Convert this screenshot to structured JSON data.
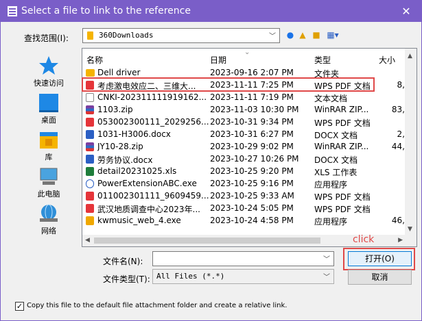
{
  "window": {
    "title": "Select a file to link to the reference",
    "close_glyph": "✕"
  },
  "lookin": {
    "label": "查找范围(I):",
    "value": "360Downloads"
  },
  "toolbar": [
    "back-icon",
    "up-folder-icon",
    "new-folder-icon",
    "view-menu-icon"
  ],
  "places": [
    {
      "label": "快速访问",
      "icon": "star-icon"
    },
    {
      "label": "桌面",
      "icon": "desktop-icon"
    },
    {
      "label": "库",
      "icon": "library-icon"
    },
    {
      "label": "此电脑",
      "icon": "computer-icon"
    },
    {
      "label": "网络",
      "icon": "network-icon"
    }
  ],
  "columns": {
    "name": "名称",
    "date": "日期",
    "type": "类型",
    "size": "大小"
  },
  "files": [
    {
      "name": "Dell driver",
      "date": "2023-09-16 2:07 PM",
      "type": "文件夹",
      "size": "",
      "icon": "folder"
    },
    {
      "name": "考虑激电效应二、三维大...",
      "date": "2023-11-11 7:25 PM",
      "type": "WPS PDF 文档",
      "size": "8,",
      "icon": "pdf"
    },
    {
      "name": "CNKI-202311111919162...",
      "date": "2023-11-11 7:19 PM",
      "type": "文本文档",
      "size": "",
      "icon": "txt"
    },
    {
      "name": "1103.zip",
      "date": "2023-11-03 10:30 PM",
      "type": "WinRAR ZIP...",
      "size": "83,",
      "icon": "zip"
    },
    {
      "name": "053002300111_2029256...",
      "date": "2023-10-31 9:34 PM",
      "type": "WPS PDF 文档",
      "size": "",
      "icon": "pdf"
    },
    {
      "name": "1031-H3006.docx",
      "date": "2023-10-31 6:27 PM",
      "type": "DOCX 文档",
      "size": "2,",
      "icon": "docx"
    },
    {
      "name": "JY10-28.zip",
      "date": "2023-10-29 9:02 PM",
      "type": "WinRAR ZIP...",
      "size": "44,",
      "icon": "zip"
    },
    {
      "name": "劳务协议.docx",
      "date": "2023-10-27 10:26 PM",
      "type": "DOCX 文档",
      "size": "",
      "icon": "docx"
    },
    {
      "name": "detail20231025.xls",
      "date": "2023-10-25 9:20 PM",
      "type": "XLS 工作表",
      "size": "",
      "icon": "xls"
    },
    {
      "name": "PowerExtensionABC.exe",
      "date": "2023-10-25 9:16 PM",
      "type": "应用程序",
      "size": "",
      "icon": "exe"
    },
    {
      "name": "011002301111_9609459...",
      "date": "2023-10-25 9:33 AM",
      "type": "WPS PDF 文档",
      "size": "",
      "icon": "pdf"
    },
    {
      "name": "武汉地质调查中心2023年...",
      "date": "2023-10-24 5:05 PM",
      "type": "WPS PDF 文档",
      "size": "",
      "icon": "pdf"
    },
    {
      "name": "kwmusic_web_4.exe",
      "date": "2023-10-24 4:58 PM",
      "type": "应用程序",
      "size": "46,",
      "icon": "music"
    }
  ],
  "filename": {
    "label": "文件名(N):",
    "value": ""
  },
  "filetype": {
    "label": "文件类型(T):",
    "value": "All Files (*.*)"
  },
  "buttons": {
    "open": "打开(O)",
    "cancel": "取消"
  },
  "annotation": {
    "click": "click",
    "color": "#e04848"
  },
  "copy_option": {
    "checked": true,
    "label": "Copy this file to the default file attachment folder and create a relative link."
  },
  "colors": {
    "titlebar": "#7a5ec8",
    "folder": "#f5b400",
    "pdf": "#e5353a"
  }
}
